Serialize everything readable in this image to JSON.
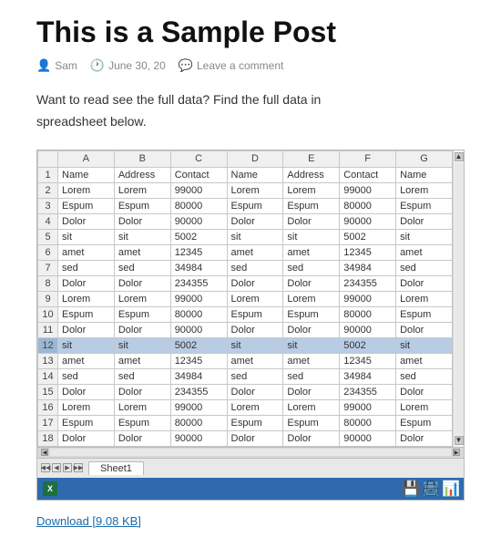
{
  "post": {
    "title": "This is a Sample Post",
    "meta": {
      "author": "Sam",
      "date": "June 30, 20",
      "comment_link": "Leave a comment"
    },
    "body_line1": "Want to read see the full data? Find the full data in",
    "body_line2": "spreadsheet below."
  },
  "spreadsheet": {
    "col_headers": [
      "",
      "A",
      "B",
      "C",
      "D",
      "E",
      "F",
      "G"
    ],
    "rows": [
      {
        "num": "1",
        "cells": [
          "Name",
          "Address",
          "Contact",
          "Name",
          "Address",
          "Contact",
          "Name"
        ],
        "highlight": false
      },
      {
        "num": "2",
        "cells": [
          "Lorem",
          "Lorem",
          "99000",
          "Lorem",
          "Lorem",
          "99000",
          "Lorem"
        ],
        "highlight": false
      },
      {
        "num": "3",
        "cells": [
          "Espum",
          "Espum",
          "80000",
          "Espum",
          "Espum",
          "80000",
          "Espum"
        ],
        "highlight": false
      },
      {
        "num": "4",
        "cells": [
          "Dolor",
          "Dolor",
          "90000",
          "Dolor",
          "Dolor",
          "90000",
          "Dolor"
        ],
        "highlight": false
      },
      {
        "num": "5",
        "cells": [
          "sit",
          "sit",
          "5002",
          "sit",
          "sit",
          "5002",
          "sit"
        ],
        "highlight": false
      },
      {
        "num": "6",
        "cells": [
          "amet",
          "amet",
          "12345",
          "amet",
          "amet",
          "12345",
          "amet"
        ],
        "highlight": false
      },
      {
        "num": "7",
        "cells": [
          "sed",
          "sed",
          "34984",
          "sed",
          "sed",
          "34984",
          "sed"
        ],
        "highlight": false
      },
      {
        "num": "8",
        "cells": [
          "Dolor",
          "Dolor",
          "234355",
          "Dolor",
          "Dolor",
          "234355",
          "Dolor"
        ],
        "highlight": false
      },
      {
        "num": "9",
        "cells": [
          "Lorem",
          "Lorem",
          "99000",
          "Lorem",
          "Lorem",
          "99000",
          "Lorem"
        ],
        "highlight": false
      },
      {
        "num": "10",
        "cells": [
          "Espum",
          "Espum",
          "80000",
          "Espum",
          "Espum",
          "80000",
          "Espum"
        ],
        "highlight": false
      },
      {
        "num": "11",
        "cells": [
          "Dolor",
          "Dolor",
          "90000",
          "Dolor",
          "Dolor",
          "90000",
          "Dolor"
        ],
        "highlight": false
      },
      {
        "num": "12",
        "cells": [
          "sit",
          "sit",
          "5002",
          "sit",
          "sit",
          "5002",
          "sit"
        ],
        "highlight": true
      },
      {
        "num": "13",
        "cells": [
          "amet",
          "amet",
          "12345",
          "amet",
          "amet",
          "12345",
          "amet"
        ],
        "highlight": false
      },
      {
        "num": "14",
        "cells": [
          "sed",
          "sed",
          "34984",
          "sed",
          "sed",
          "34984",
          "sed"
        ],
        "highlight": false
      },
      {
        "num": "15",
        "cells": [
          "Dolor",
          "Dolor",
          "234355",
          "Dolor",
          "Dolor",
          "234355",
          "Dolor"
        ],
        "highlight": false
      },
      {
        "num": "16",
        "cells": [
          "Lorem",
          "Lorem",
          "99000",
          "Lorem",
          "Lorem",
          "99000",
          "Lorem"
        ],
        "highlight": false
      },
      {
        "num": "17",
        "cells": [
          "Espum",
          "Espum",
          "80000",
          "Espum",
          "Espum",
          "80000",
          "Espum"
        ],
        "highlight": false
      },
      {
        "num": "18",
        "cells": [
          "Dolor",
          "Dolor",
          "90000",
          "Dolor",
          "Dolor",
          "90000",
          "Dolor"
        ],
        "highlight": false
      }
    ],
    "sheet_tab": "Sheet1"
  },
  "download": {
    "label": "Download [9.08 KB]"
  }
}
